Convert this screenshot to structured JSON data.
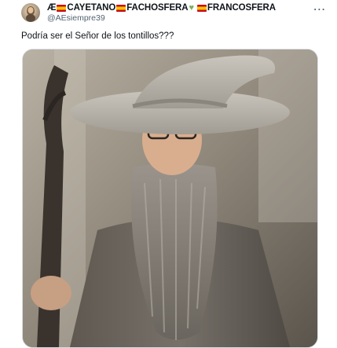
{
  "tweet": {
    "display_name": "CAYETANO",
    "name_part_2": "FACHOSFERA",
    "name_part_3": "FRANCOSFERA",
    "name_prefix_symbol": "Æ",
    "handle": "@AEsiempre39",
    "text": "Podría ser el Señor de los tontillos???",
    "more_icon": "⋯"
  },
  "media": {
    "description": "photo",
    "icon": "photo-icon"
  },
  "colors": {
    "handle": "#536471",
    "spanish_flag_red": "#c60b1e",
    "spanish_flag_yellow": "#ffc400",
    "green_heart": "#78b159"
  }
}
